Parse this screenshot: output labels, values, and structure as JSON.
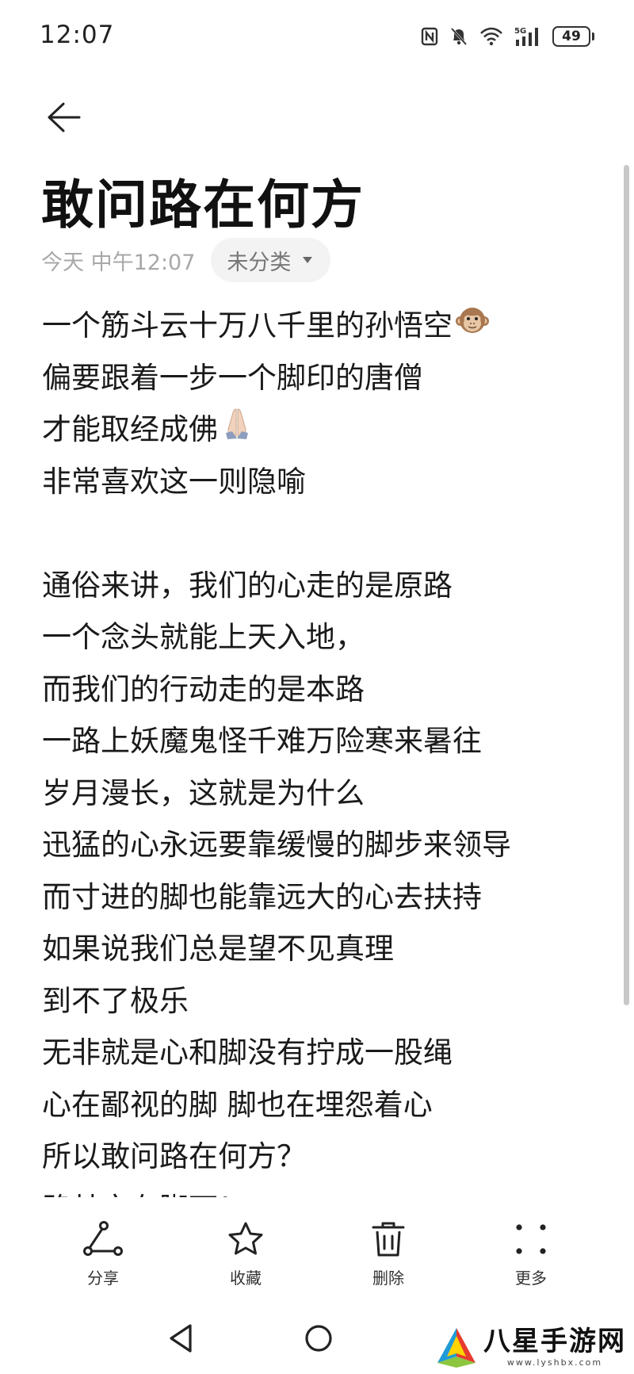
{
  "status_bar": {
    "time": "12:07",
    "battery": "49",
    "network": "5G",
    "icons": [
      "nfc-icon",
      "mute-icon",
      "wifi-icon",
      "signal-icon",
      "battery-icon"
    ]
  },
  "note": {
    "title": "敢问路在何方",
    "date": "今天 中午12:07",
    "category": "未分类",
    "lines": [
      "一个筋斗云十万八千里的孙悟空",
      "偏要跟着一步一个脚印的唐僧",
      "才能取经成佛",
      "非常喜欢这一则隐喻",
      "",
      "通俗来讲，我们的心走的是原路",
      "一个念头就能上天入地，",
      "而我们的行动走的是本路",
      "一路上妖魔鬼怪千难万险寒来暑往",
      "岁月漫长，这就是为什么",
      "迅猛的心永远要靠缓慢的脚步来领导",
      "而寸进的脚也能靠远大的心去扶持",
      "如果说我们总是望不见真理",
      "到不了极乐",
      "无非就是心和脚没有拧成一股绳",
      "心在鄙视的脚 脚也在埋怨着心",
      "所以敢问路在何方？",
      "路其实在脚下！"
    ],
    "emojis": {
      "line_0": "🐵",
      "line_2": "🙏🏻"
    }
  },
  "toolbar": {
    "share": "分享",
    "favorite": "收藏",
    "delete": "删除",
    "more": "更多"
  },
  "watermark": {
    "main": "八星手游网",
    "sub": "www.lyshbx.com"
  },
  "colors": {
    "text": "#1a1a1a",
    "meta": "#a8a8a8",
    "chip_bg": "#f3f3f3"
  }
}
